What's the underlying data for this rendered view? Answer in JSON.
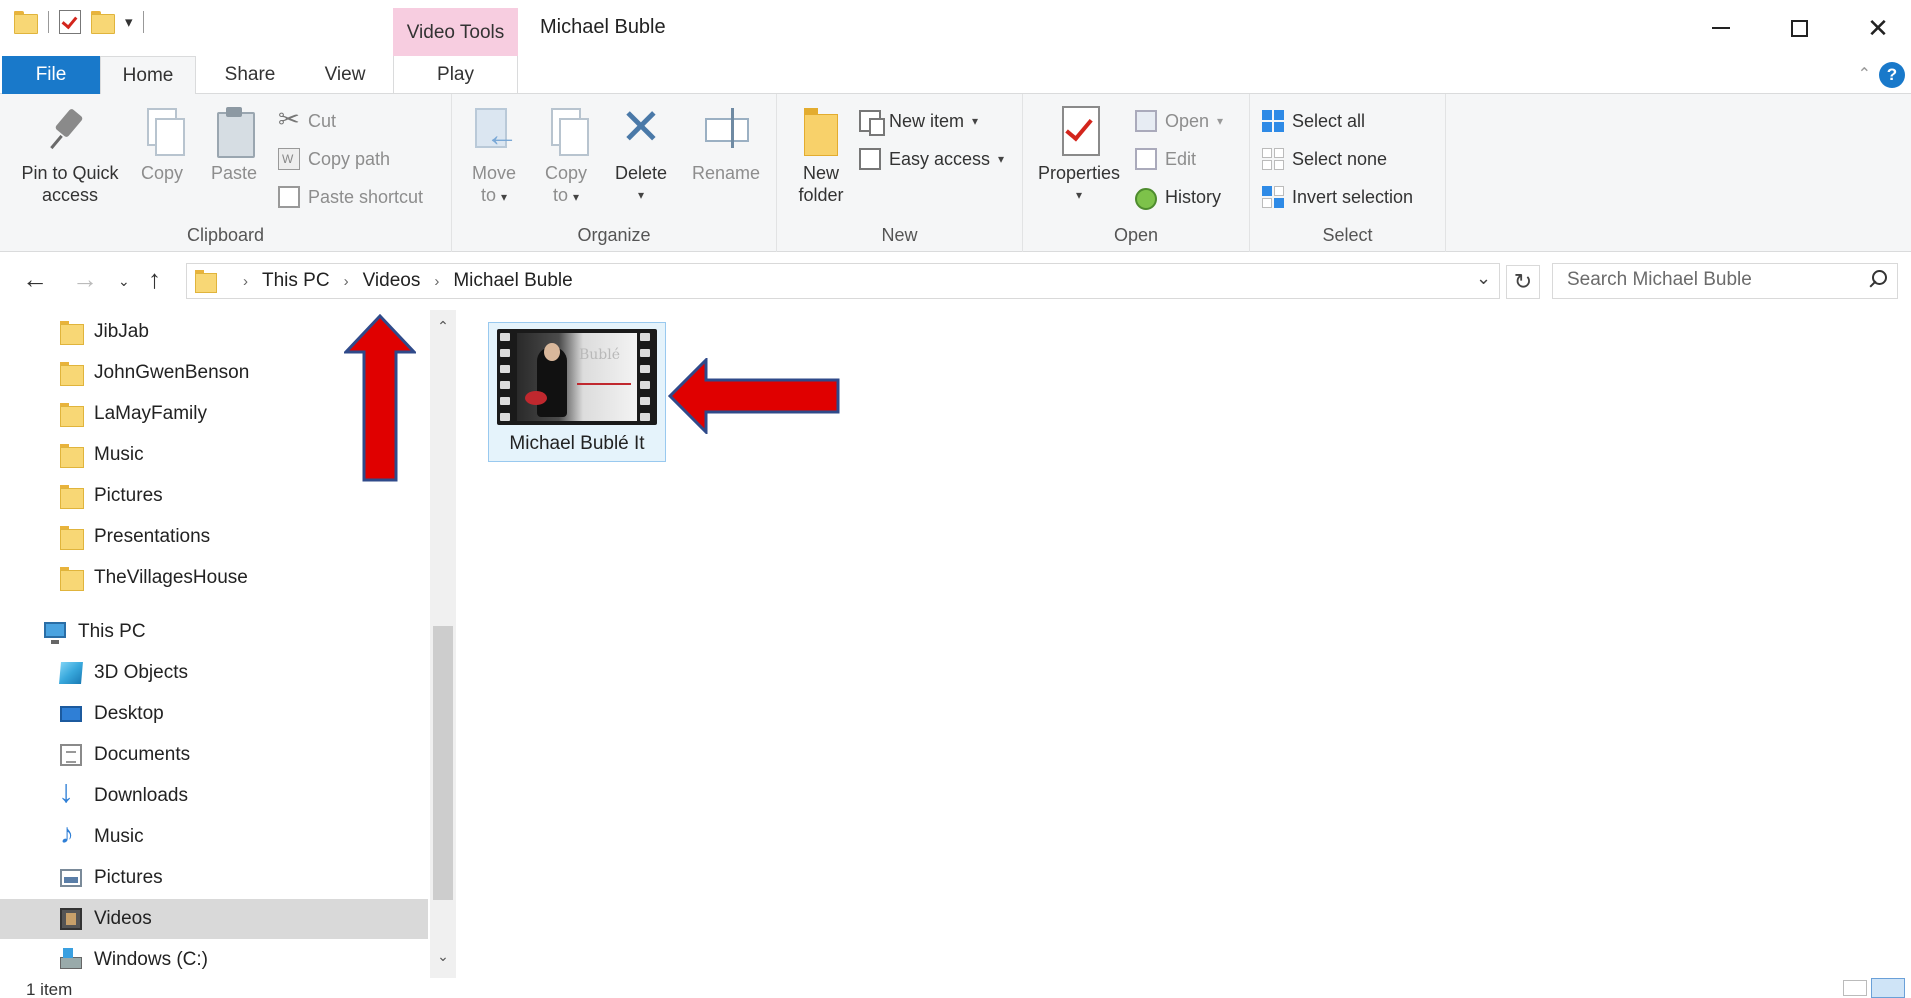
{
  "window": {
    "title": "Michael Buble",
    "contextual_tab": "Video Tools"
  },
  "ribbon_tabs": {
    "file": "File",
    "home": "Home",
    "share": "Share",
    "view": "View",
    "play": "Play",
    "help": "?"
  },
  "ribbon": {
    "clipboard": {
      "label": "Clipboard",
      "pin_line1": "Pin to Quick",
      "pin_line2": "access",
      "copy": "Copy",
      "paste": "Paste",
      "cut": "Cut",
      "copy_path": "Copy path",
      "paste_shortcut": "Paste shortcut"
    },
    "organize": {
      "label": "Organize",
      "move_line1": "Move",
      "move_line2": "to",
      "copy_line1": "Copy",
      "copy_line2": "to",
      "delete": "Delete",
      "rename": "Rename"
    },
    "new": {
      "label": "New",
      "new_folder_line1": "New",
      "new_folder_line2": "folder",
      "new_item": "New item",
      "easy_access": "Easy access"
    },
    "open": {
      "label": "Open",
      "properties": "Properties",
      "open": "Open",
      "edit": "Edit",
      "history": "History"
    },
    "select": {
      "label": "Select",
      "select_all": "Select all",
      "select_none": "Select none",
      "invert_selection": "Invert selection"
    }
  },
  "address": {
    "crumbs": [
      "This PC",
      "Videos",
      "Michael Buble"
    ],
    "search_placeholder": "Search Michael Buble"
  },
  "nav_pane": {
    "folders": [
      "JibJab",
      "JohnGwenBenson",
      "LaMayFamily",
      "Music",
      "Pictures",
      "Presentations",
      "TheVillagesHouse"
    ],
    "this_pc": "This PC",
    "pc_items": [
      "3D Objects",
      "Desktop",
      "Documents",
      "Downloads",
      "Music",
      "Pictures",
      "Videos",
      "Windows (C:)"
    ],
    "selected": "Videos"
  },
  "content": {
    "files": [
      {
        "name": "Michael Bublé   It",
        "thumb_text": "Bublé"
      }
    ]
  },
  "annotations": {
    "arrow_color": "#e00000",
    "arrow_outline": "#2f4a8a"
  },
  "status": {
    "count": "1 item"
  }
}
